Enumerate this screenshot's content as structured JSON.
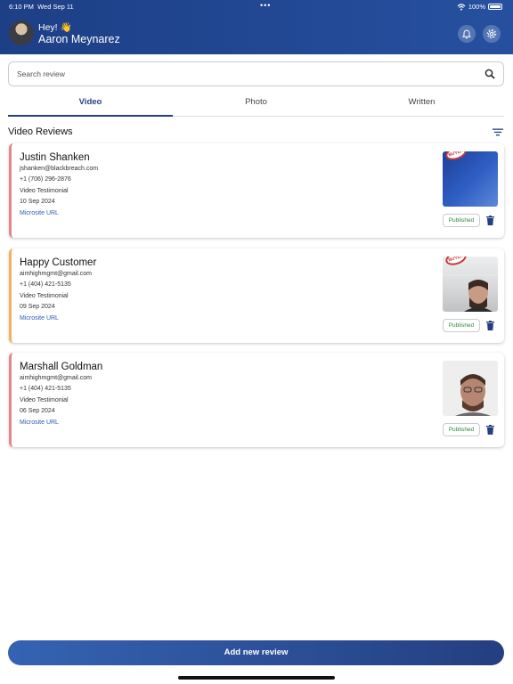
{
  "status_bar": {
    "time": "6:10 PM",
    "date": "Wed Sep 11",
    "battery": "100%"
  },
  "header": {
    "greeting": "Hey! 👋",
    "user_name": "Aaron Meynarez"
  },
  "search": {
    "placeholder": "Search review",
    "value": ""
  },
  "tabs": [
    {
      "label": "Video",
      "active": true
    },
    {
      "label": "Photo",
      "active": false
    },
    {
      "label": "Written",
      "active": false
    }
  ],
  "section": {
    "title": "Video Reviews"
  },
  "reviews": [
    {
      "name": "Justin Shanken",
      "email": "jshanken@blackbreach.com",
      "phone": "+1 (706) 296-2876",
      "type": "Video Testimonial",
      "date": "10 Sep 2024",
      "link": "Microsite URL",
      "status": "Published",
      "stamp": "BUYER",
      "accent": "#e5868a"
    },
    {
      "name": "Happy Customer",
      "email": "aimhighmgmt@gmail.com",
      "phone": "+1 (404) 421-5135",
      "type": "Video Testimonial",
      "date": "09 Sep 2024",
      "link": "Microsite URL",
      "status": "Published",
      "stamp": "BUYER",
      "accent": "#f0b25a"
    },
    {
      "name": "Marshall Goldman",
      "email": "aimhighmgmt@gmail.com",
      "phone": "+1 (404) 421-5135",
      "type": "Video Testimonial",
      "date": "06 Sep 2024",
      "link": "Microsite URL",
      "status": "Published",
      "accent": "#e5868a"
    }
  ],
  "footer": {
    "add_button": "Add new review"
  },
  "colors": {
    "primary": "#243f80",
    "published": "#2e8b3e",
    "link": "#2d5db4"
  },
  "icons": [
    "bell-icon",
    "gear-icon",
    "search-icon",
    "sort-icon",
    "trash-icon",
    "wifi-icon",
    "battery-icon"
  ]
}
